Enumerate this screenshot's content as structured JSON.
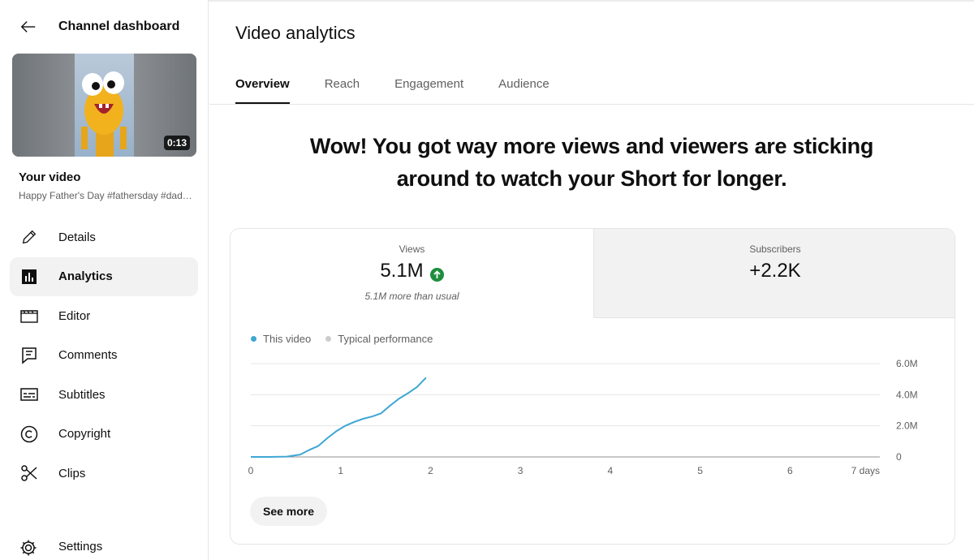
{
  "sidebar": {
    "title": "Channel dashboard",
    "thumbnail": {
      "duration": "0:13"
    },
    "your_video_label": "Your video",
    "video_title": "Happy Father's Day #fathersday #dad #shorts",
    "items": [
      {
        "label": "Details",
        "icon": "pencil-icon"
      },
      {
        "label": "Analytics",
        "icon": "bar-chart-icon",
        "active": true
      },
      {
        "label": "Editor",
        "icon": "clapperboard-icon"
      },
      {
        "label": "Comments",
        "icon": "comment-icon"
      },
      {
        "label": "Subtitles",
        "icon": "subtitles-icon"
      },
      {
        "label": "Copyright",
        "icon": "copyright-icon"
      },
      {
        "label": "Clips",
        "icon": "scissors-icon"
      }
    ],
    "settings_label": "Settings"
  },
  "main": {
    "title": "Video analytics",
    "tabs": [
      "Overview",
      "Reach",
      "Engagement",
      "Audience"
    ],
    "active_tab": "Overview",
    "headline": "Wow! You got way more views and viewers are sticking around to watch your Short for longer.",
    "metrics": {
      "views": {
        "label": "Views",
        "value": "5.1M",
        "note": "5.1M more than usual"
      },
      "subscribers": {
        "label": "Subscribers",
        "value": "+2.2K"
      }
    },
    "legend": {
      "this_video": "This video",
      "typical": "Typical performance"
    },
    "see_more": "See more"
  },
  "colors": {
    "series": "#3ea6d4",
    "typical": "#cccccc",
    "up_badge": "#1e8e3e",
    "accent_tab": "#0f0f0f"
  },
  "chart_data": {
    "type": "line",
    "x_ticks": [
      "0",
      "1",
      "2",
      "3",
      "4",
      "5",
      "6",
      "7 days"
    ],
    "y_ticks": [
      "0",
      "2.0M",
      "4.0M",
      "6.0M"
    ],
    "xlim": [
      0,
      7
    ],
    "ylim": [
      0,
      6000000
    ],
    "series": [
      {
        "name": "This video",
        "x": [
          0,
          0.2,
          0.4,
          0.55,
          0.65,
          0.75,
          0.85,
          0.95,
          1.05,
          1.15,
          1.25,
          1.35,
          1.45,
          1.55,
          1.65,
          1.75,
          1.85,
          1.95
        ],
        "y": [
          0,
          0,
          20000,
          150000,
          450000,
          700000,
          1200000,
          1650000,
          2000000,
          2250000,
          2450000,
          2600000,
          2800000,
          3300000,
          3750000,
          4100000,
          4500000,
          5100000
        ]
      }
    ]
  }
}
